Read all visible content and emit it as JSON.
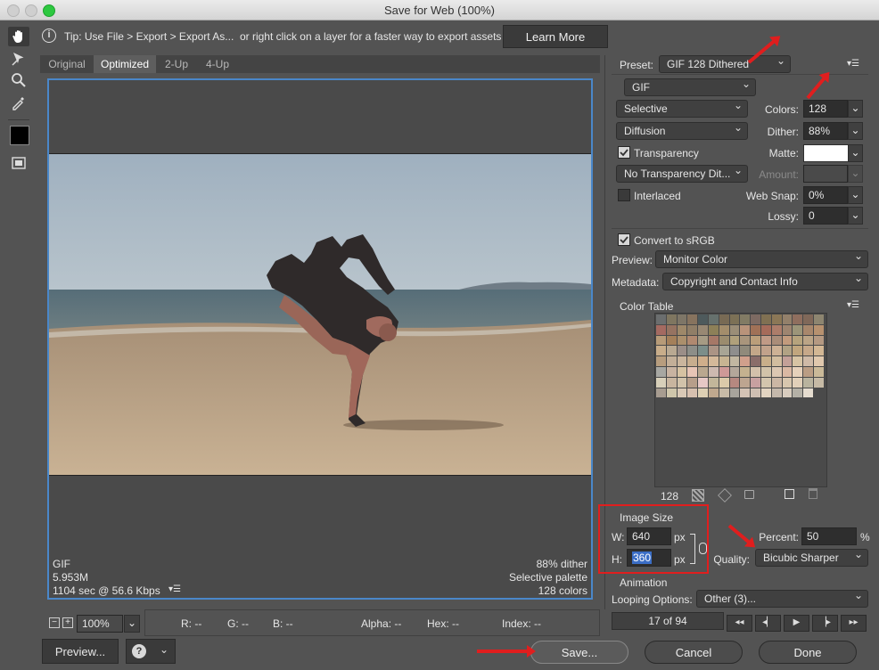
{
  "window": {
    "title": "Save for Web (100%)"
  },
  "tip": {
    "text": "Tip: Use File > Export > Export As...  or right click on a layer for a faster way to export assets",
    "learn_more": "Learn More"
  },
  "tabs": [
    "Original",
    "Optimized",
    "2-Up",
    "4-Up"
  ],
  "active_tab": "Optimized",
  "canvas_info": {
    "format": "GIF",
    "size": "5.953M",
    "time": "1104 sec @ 56.6 Kbps",
    "dither": "88% dither",
    "palette": "Selective palette",
    "colors": "128 colors"
  },
  "zoom": {
    "value": "100%"
  },
  "readout": {
    "r": "R: --",
    "g": "G: --",
    "b": "B: --",
    "alpha": "Alpha: --",
    "hex": "Hex: --",
    "index": "Index: --"
  },
  "bottom": {
    "preview": "Preview...",
    "save": "Save...",
    "cancel": "Cancel",
    "done": "Done"
  },
  "settings": {
    "preset_label": "Preset:",
    "preset_value": "GIF 128 Dithered",
    "format": "GIF",
    "reduction": "Selective",
    "colors_label": "Colors:",
    "colors_value": "128",
    "dither_algo": "Diffusion",
    "dither_label": "Dither:",
    "dither_value": "88%",
    "transparency_label": "Transparency",
    "matte_label": "Matte:",
    "trans_dither": "No Transparency Dit...",
    "amount_label": "Amount:",
    "interlaced_label": "Interlaced",
    "websnap_label": "Web Snap:",
    "websnap_value": "0%",
    "lossy_label": "Lossy:",
    "lossy_value": "0",
    "convert_srgb_label": "Convert to sRGB",
    "preview_label": "Preview:",
    "preview_value": "Monitor Color",
    "metadata_label": "Metadata:",
    "metadata_value": "Copyright and Contact Info"
  },
  "color_table": {
    "title": "Color Table",
    "count": "128",
    "swatches": [
      "#6b6e6f",
      "#7f7660",
      "#7e7667",
      "#87735e",
      "#4e5a5c",
      "#66716d",
      "#786a54",
      "#7c7156",
      "#827b64",
      "#7d6a62",
      "#807052",
      "#8b7756",
      "#93806a",
      "#8f6e5e",
      "#806859",
      "#8d8570",
      "#a46a61",
      "#967361",
      "#9e8869",
      "#907e67",
      "#988873",
      "#8d8058",
      "#a38d6b",
      "#9b8e77",
      "#b9937a",
      "#a07157",
      "#a66b5a",
      "#ad7d6a",
      "#9e8570",
      "#9c9579",
      "#a8876c",
      "#b7916f",
      "#b79b78",
      "#a4805a",
      "#ab8f6c",
      "#b08970",
      "#a69b84",
      "#a67867",
      "#9b8c6e",
      "#b0a07b",
      "#a9957c",
      "#bb9e7a",
      "#c09a86",
      "#aa8d79",
      "#c29b7d",
      "#b6a37d",
      "#bba486",
      "#b59982",
      "#c8ad8a",
      "#b9a992",
      "#9b8e88",
      "#8d8e88",
      "#7c8e8a",
      "#ab9485",
      "#a8a595",
      "#8f8e8d",
      "#908a7b",
      "#c3a789",
      "#c1a28b",
      "#cdb195",
      "#b1a284",
      "#c1a67e",
      "#c6a889",
      "#d3b794",
      "#b79d7e",
      "#c3af98",
      "#cab59d",
      "#c7ad8e",
      "#cfae8b",
      "#d4b99a",
      "#c7b492",
      "#c2b7a1",
      "#d0a08c",
      "#8a6d6a",
      "#c8af8a",
      "#d2bd9f",
      "#c3a098",
      "#d7c4a4",
      "#cfbaa7",
      "#e0c8ad",
      "#a7a7a2",
      "#c8b3a1",
      "#d6c2a2",
      "#e7c4b5",
      "#b9a78f",
      "#cdb9b0",
      "#ce9997",
      "#b4a79a",
      "#c4b18f",
      "#d3c0ab",
      "#d1c3a9",
      "#dcc7b2",
      "#dab8a3",
      "#e6d1bb",
      "#ba9d84",
      "#cab998",
      "#d7cfb9",
      "#c8b59f",
      "#d1c2aa",
      "#b79e8a",
      "#e6c8c5",
      "#c2b69a",
      "#dbcaa9",
      "#b68880",
      "#bda590",
      "#c8a0a0",
      "#d3c5ad",
      "#cbb6a4",
      "#d8c6ae",
      "#e2d0b9",
      "#b9b39e",
      "#c6baa5",
      "#a79c90",
      "#cfc6ab",
      "#d9c9b6",
      "#d7c0af",
      "#ded0b4",
      "#bfa88e",
      "#c8bba7",
      "#a8a49c",
      "#d4c3b5",
      "#cfbfb2",
      "#e2d4c1",
      "#c4b8ab",
      "#d8ccbe",
      "#b4b0a6",
      "#e5dccf"
    ]
  },
  "image_size": {
    "title": "Image Size",
    "w_label": "W:",
    "w_value": "640",
    "h_label": "H:",
    "h_value": "360",
    "unit": "px",
    "percent_label": "Percent:",
    "percent_value": "50",
    "percent_unit": "%",
    "quality_label": "Quality:",
    "quality_value": "Bicubic Sharper"
  },
  "animation": {
    "title": "Animation",
    "looping_label": "Looping Options:",
    "looping_value": "Other (3)...",
    "frame": "17 of 94"
  },
  "colors": {
    "accent": "#4a87c9",
    "highlight": "#e01e1e",
    "panel": "#535353"
  }
}
